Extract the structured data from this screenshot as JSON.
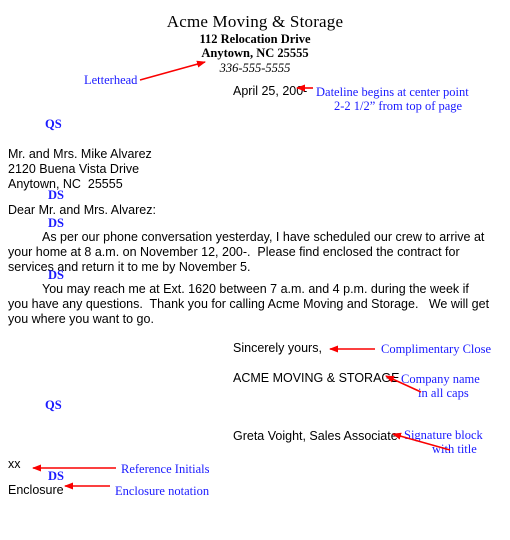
{
  "letterhead": {
    "company": "Acme Moving & Storage",
    "street": "112 Relocation Drive",
    "city_state_zip": "Anytown, NC 25555",
    "phone": "336-555-5555"
  },
  "letter": {
    "dateline": "April 25, 200-",
    "inside_address": "Mr. and Mrs. Mike Alvarez\n2120 Buena Vista Drive\nAnytown, NC  25555",
    "salutation": "Dear Mr. and Mrs. Alvarez:",
    "paragraph_1": "As per our phone conversation yesterday, I have scheduled our crew to arrive at your home at 8 a.m. on November 12, 200-.  Please find enclosed the contract for services and return it to me by November 5.",
    "paragraph_2": "You may reach me at Ext. 1620 between 7 a.m. and 4 p.m. during the week if you have any questions.  Thank you for calling Acme Moving and Storage.   We will get you where you want to go.",
    "complimentary_close": "Sincerely yours,",
    "company_name": "ACME MOVING & STORAGE",
    "signature_block": "Greta Voight, Sales Associate",
    "reference_initials": "xx",
    "enclosure_notation": "Enclosure"
  },
  "markers": {
    "qs_after_letterhead": "QS",
    "ds_after_address": "DS",
    "ds_after_salutation": "DS",
    "ds_between_paragraphs": "DS",
    "qs_after_company": "QS",
    "ds_after_initials": "DS"
  },
  "annotations": {
    "letterhead": "Letterhead",
    "dateline_line1": "Dateline begins at center point",
    "dateline_line2": "2-2 1/2” from top of page",
    "complimentary_close": "Complimentary Close",
    "company_name_line1": "Company name",
    "company_name_line2": "in all caps",
    "signature_block_line1": "Signature block",
    "signature_block_line2": "with title",
    "reference_initials": "Reference Initials",
    "enclosure_notation": "Enclosure notation"
  },
  "colors": {
    "annotation_blue": "#1a1aff",
    "arrow_red": "#fa0000",
    "letter_black": "#000000",
    "page_background": "#ffffff"
  }
}
